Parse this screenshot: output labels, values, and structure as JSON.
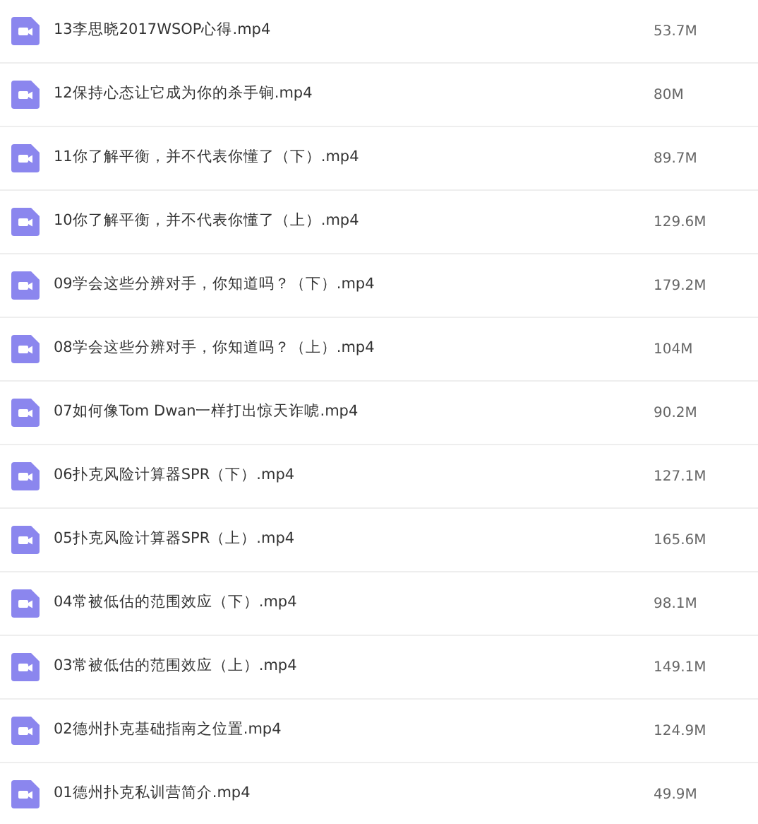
{
  "files": [
    {
      "name": "13李思晓2017WSOP心得.mp4",
      "size": "53.7M"
    },
    {
      "name": "12保持心态让它成为你的杀手锏.mp4",
      "size": "80M"
    },
    {
      "name": "11你了解平衡，并不代表你懂了（下）.mp4",
      "size": "89.7M"
    },
    {
      "name": "10你了解平衡，并不代表你懂了（上）.mp4",
      "size": "129.6M"
    },
    {
      "name": "09学会这些分辨对手，你知道吗？（下）.mp4",
      "size": "179.2M"
    },
    {
      "name": "08学会这些分辨对手，你知道吗？（上）.mp4",
      "size": "104M"
    },
    {
      "name": "07如何像Tom Dwan一样打出惊天诈唬.mp4",
      "size": "90.2M"
    },
    {
      "name": "06扑克风险计算器SPR（下）.mp4",
      "size": "127.1M"
    },
    {
      "name": "05扑克风险计算器SPR（上）.mp4",
      "size": "165.6M"
    },
    {
      "name": "04常被低估的范围效应（下）.mp4",
      "size": "98.1M"
    },
    {
      "name": "03常被低估的范围效应（上）.mp4",
      "size": "149.1M"
    },
    {
      "name": "02德州扑克基础指南之位置.mp4",
      "size": "124.9M"
    },
    {
      "name": "01德州扑克私训营简介.mp4",
      "size": "49.9M"
    }
  ]
}
